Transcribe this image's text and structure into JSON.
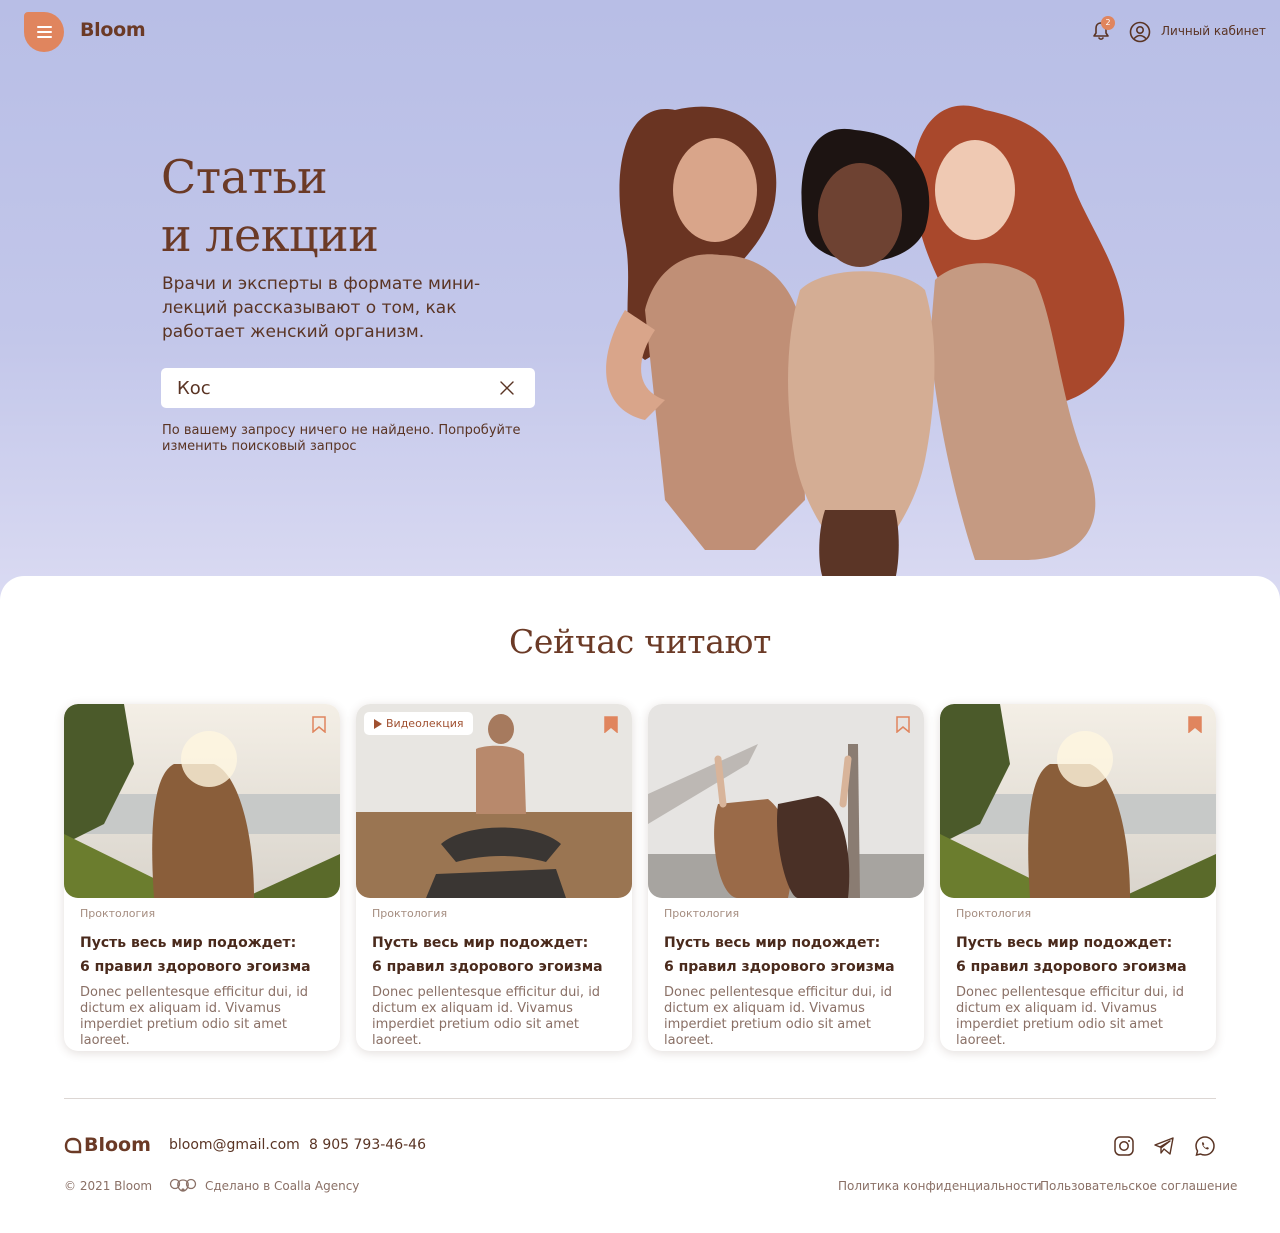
{
  "header": {
    "logo": "Bloom",
    "notifications_count": "2",
    "account_label": "Личный кабинет"
  },
  "hero": {
    "title_line1": "Статьи",
    "title_line2": "и лекции",
    "subtitle": "Врачи и эксперты в формате мини-лекций рассказывают о том, как работает женский организм.",
    "search_value": "Кос",
    "search_message": "По вашему запросу ничего не найдено. Попробуйте изменить поисковый запрос"
  },
  "section": {
    "title": "Сейчас читают"
  },
  "cards": [
    {
      "category": "Проктология",
      "title_line1": "Пусть весь мир подождет:",
      "title_line2": "6 правил здорового эгоизма",
      "text": "Donec pellentesque efficitur dui, id dictum ex aliquam id. Vivamus imperdiet pretium odio sit amet laoreet.",
      "bookmarked": false,
      "badge": ""
    },
    {
      "category": "Проктология",
      "title_line1": "Пусть весь мир подождет:",
      "title_line2": "6 правил здорового эгоизма",
      "text": "Donec pellentesque efficitur dui, id dictum ex aliquam id. Vivamus imperdiet pretium odio sit amet laoreet.",
      "bookmarked": true,
      "badge": "Видеолекция"
    },
    {
      "category": "Проктология",
      "title_line1": "Пусть весь мир подождет:",
      "title_line2": "6 правил здорового эгоизма",
      "text": "Donec pellentesque efficitur dui, id dictum ex aliquam id. Vivamus imperdiet pretium odio sit amet laoreet.",
      "bookmarked": false,
      "badge": ""
    },
    {
      "category": "Проктология",
      "title_line1": "Пусть весь мир подождет:",
      "title_line2": "6 правил здорового эгоизма",
      "text": "Donec pellentesque efficitur dui, id dictum ex aliquam id. Vivamus imperdiet pretium odio sit amet laoreet.",
      "bookmarked": true,
      "badge": ""
    }
  ],
  "footer": {
    "logo": "Bloom",
    "email": "bloom@gmail.com",
    "phone": "8 905 793-46-46",
    "copyright": "© 2021 Bloom",
    "agency": "Сделано в Coalla Agency",
    "privacy": "Политика конфиденциальности",
    "terms": "Пользовательское соглашение",
    "social_icons": [
      "instagram-icon",
      "telegram-icon",
      "whatsapp-icon"
    ]
  },
  "colors": {
    "accent": "#e0855e",
    "brand_brown": "#6b3a26",
    "hero_bg": "#b8bee6"
  }
}
